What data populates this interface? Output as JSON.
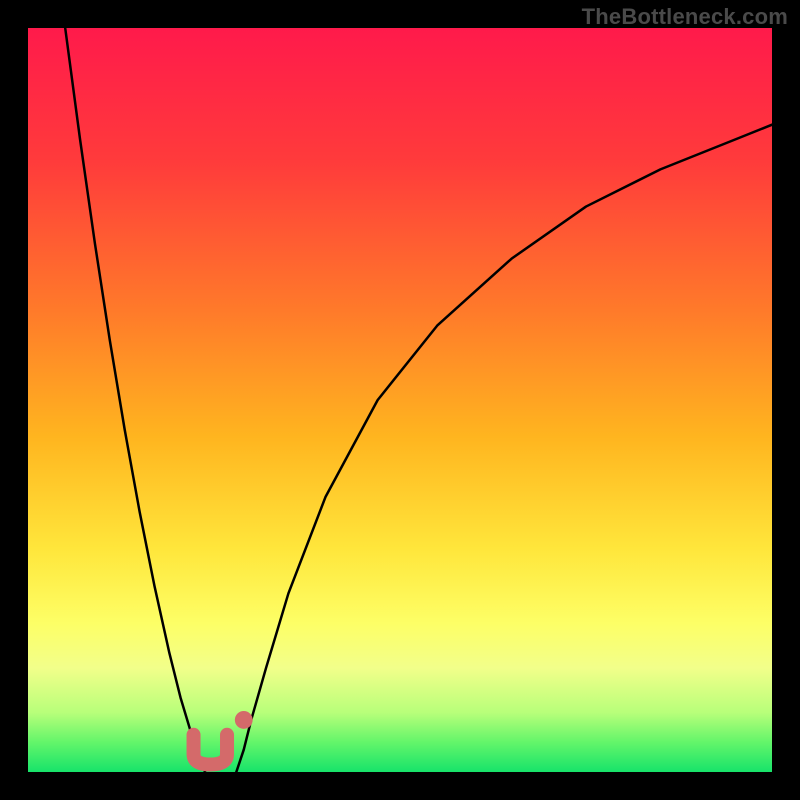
{
  "watermark": "TheBottleneck.com",
  "chart_data": {
    "type": "line",
    "title": "",
    "xlabel": "",
    "ylabel": "",
    "xlim": [
      0,
      100
    ],
    "ylim": [
      0,
      100
    ],
    "gradient_stops": [
      {
        "offset": 0,
        "color": "#ff1a4b"
      },
      {
        "offset": 18,
        "color": "#ff3b3b"
      },
      {
        "offset": 38,
        "color": "#ff7a2a"
      },
      {
        "offset": 55,
        "color": "#ffb51f"
      },
      {
        "offset": 70,
        "color": "#ffe63b"
      },
      {
        "offset": 80,
        "color": "#fdff66"
      },
      {
        "offset": 86,
        "color": "#f2ff8a"
      },
      {
        "offset": 92,
        "color": "#b8ff7a"
      },
      {
        "offset": 96,
        "color": "#63f56a"
      },
      {
        "offset": 100,
        "color": "#17e36a"
      }
    ],
    "series": [
      {
        "name": "left-curve",
        "x": [
          5,
          7,
          9,
          11,
          13,
          15,
          17,
          19,
          20.5,
          22,
          23,
          23.8
        ],
        "values": [
          100,
          85,
          71,
          58,
          46,
          35,
          25,
          16,
          10,
          5,
          2,
          0
        ]
      },
      {
        "name": "right-curve",
        "x": [
          28,
          29,
          30,
          32,
          35,
          40,
          47,
          55,
          65,
          75,
          85,
          95,
          100
        ],
        "values": [
          0,
          3,
          7,
          14,
          24,
          37,
          50,
          60,
          69,
          76,
          81,
          85,
          87
        ]
      }
    ],
    "markers": [
      {
        "shape": "u",
        "x_center": 24.5,
        "y_center": 3.0,
        "width": 4.5,
        "height": 4.0,
        "stroke": "#d46a6a",
        "stroke_width": 14
      },
      {
        "shape": "dot",
        "x": 29.0,
        "y": 7.0,
        "r": 1.2,
        "fill": "#d46a6a"
      }
    ]
  }
}
